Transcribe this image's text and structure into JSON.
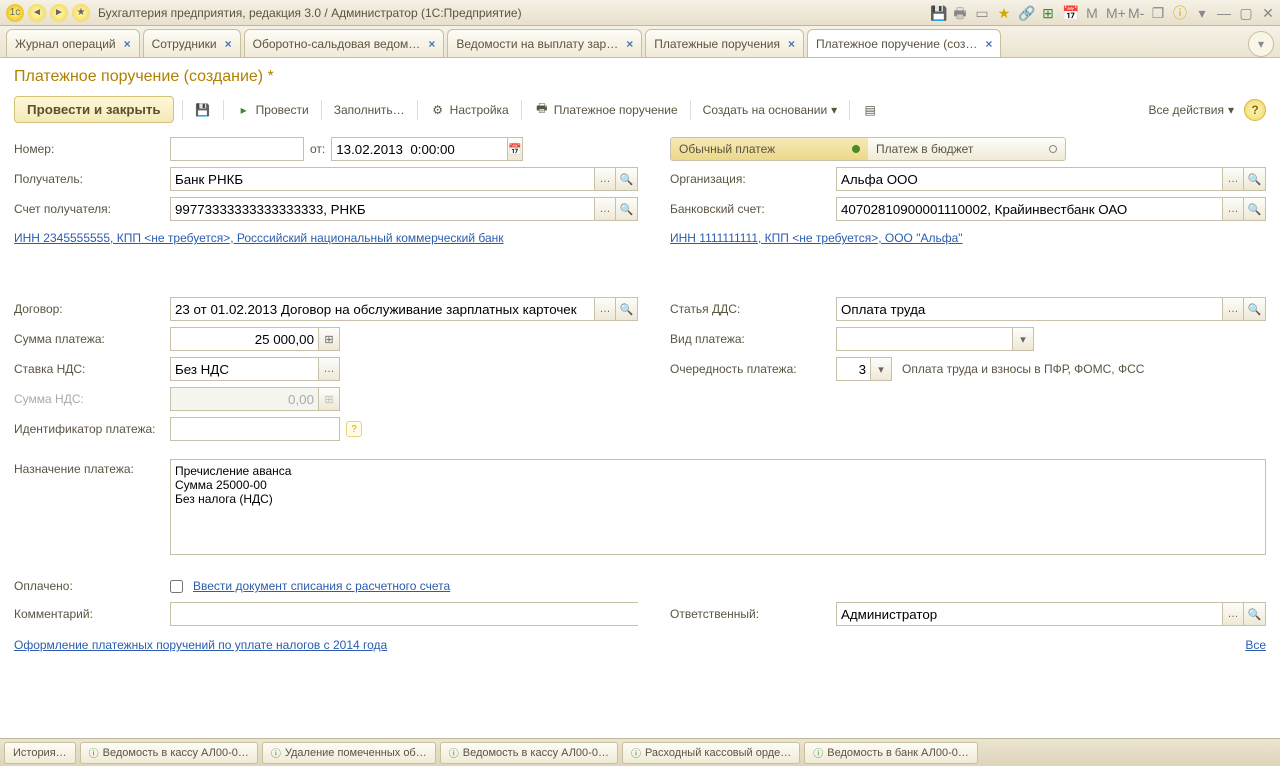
{
  "title": "Бухгалтерия предприятия, редакция 3.0 / Администратор  (1С:Предприятие)",
  "tabs": [
    {
      "label": "Журнал операций"
    },
    {
      "label": "Сотрудники"
    },
    {
      "label": "Оборотно-сальдовая ведом…"
    },
    {
      "label": "Ведомости на выплату зар…"
    },
    {
      "label": "Платежные поручения"
    },
    {
      "label": "Платежное поручение (соз…",
      "active": true
    }
  ],
  "page_title": "Платежное поручение (создание) *",
  "toolbar": {
    "post_close": "Провести и закрыть",
    "post": "Провести",
    "fill": "Заполнить…",
    "settings": "Настройка",
    "print": "Платежное поручение",
    "create_based": "Создать на основании",
    "all_actions": "Все действия"
  },
  "labels": {
    "number": "Номер:",
    "from": "от:",
    "recipient": "Получатель:",
    "recipient_account": "Счет получателя:",
    "organization": "Организация:",
    "bank_account": "Банковский счет:",
    "contract": "Договор:",
    "dds": "Статья ДДС:",
    "payment_amount": "Сумма платежа:",
    "payment_type": "Вид платежа:",
    "vat_rate": "Ставка НДС:",
    "priority": "Очередность платежа:",
    "vat_amount": "Сумма НДС:",
    "payment_id": "Идентификатор платежа:",
    "purpose": "Назначение платежа:",
    "paid": "Оплачено:",
    "comment": "Комментарий:",
    "responsible": "Ответственный:"
  },
  "values": {
    "date": "13.02.2013  0:00:00",
    "recipient": "Банк РНКБ",
    "recipient_account": "99773333333333333333, РНКБ",
    "organization": "Альфа ООО",
    "bank_account": "40702810900001110002, Крайинвестбанк ОАО",
    "link_left": "ИНН 2345555555, КПП <не требуется>, Росссийский национальный коммерческий банк",
    "link_right": "ИНН 1111111111, КПП <не требуется>, ООО \"Альфа\"",
    "contract": "23 от 01.02.2013 Договор на обслуживание зарплатных карточек",
    "dds": "Оплата труда",
    "amount": "25 000,00",
    "vat_rate": "Без НДС",
    "vat_amount": "0,00",
    "priority": "3",
    "priority_desc": "Оплата труда и взносы в ПФР, ФОМС, ФСС",
    "purpose": "Пречисление аванса\nСумма 25000-00\nБез налога (НДС)",
    "responsible": "Администратор",
    "create_link": "Ввести документ списания с расчетного счета"
  },
  "toggles": {
    "regular": "Обычный платеж",
    "budget": "Платеж в бюджет"
  },
  "footer": {
    "tax_link": "Оформление платежных поручений по уплате налогов с 2014 года",
    "all": "Все"
  },
  "taskbar": {
    "history": "История…",
    "items": [
      "Ведомость в кассу АЛ00-0…",
      "Удаление помеченных об…",
      "Ведомость в кассу АЛ00-0…",
      "Расходный кассовый орде…",
      "Ведомость в банк АЛ00-0…"
    ]
  }
}
